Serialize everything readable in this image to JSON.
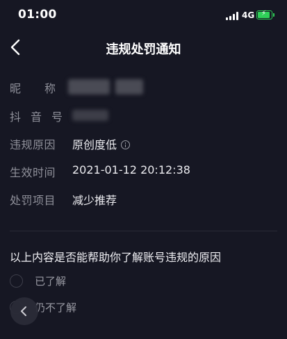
{
  "status_bar": {
    "time": "01:00",
    "network": "4G"
  },
  "header": {
    "title": "违规处罚通知"
  },
  "info": {
    "nickname_label": "昵称",
    "douyin_id_label": "抖音号",
    "reason_label": "违规原因",
    "reason_value": "原创度低",
    "time_label": "生效时间",
    "time_value": "2021-01-12 20:12:38",
    "penalty_label": "处罚项目",
    "penalty_value": "减少推荐"
  },
  "feedback": {
    "question": "以上内容是否能帮助你了解账号违规的原因",
    "options": [
      "已了解",
      "仍不了解"
    ]
  },
  "colors": {
    "background": "#161723",
    "battery": "#2fd158",
    "label": "#8f909a",
    "value": "#ececf0"
  }
}
